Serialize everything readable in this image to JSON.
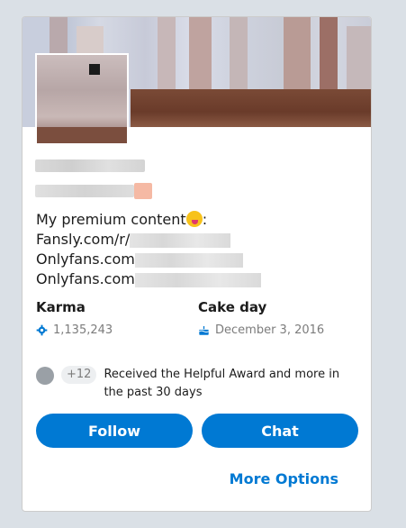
{
  "profile": {
    "bio_lines": [
      {
        "prefix": "My premium content",
        "suffix": ":"
      },
      {
        "prefix": "Fansly.com/r/"
      },
      {
        "prefix": "Onlyfans.com"
      },
      {
        "prefix": "Onlyfans.com"
      }
    ]
  },
  "stats": {
    "karma_label": "Karma",
    "karma_value": "1,135,243",
    "cake_label": "Cake day",
    "cake_value": "December 3, 2016"
  },
  "awards": {
    "extra_count": "+12",
    "text": "Received the Helpful Award and more in the past 30 days"
  },
  "actions": {
    "follow_label": "Follow",
    "chat_label": "Chat",
    "more_label": "More Options"
  },
  "colors": {
    "accent": "#0079d3",
    "page_bg": "#dae0e6"
  },
  "icons": {
    "karma": "karma-gear-icon",
    "cake": "cake-icon",
    "award": "award-icon",
    "emoji": "tongue-out-emoji-icon"
  }
}
